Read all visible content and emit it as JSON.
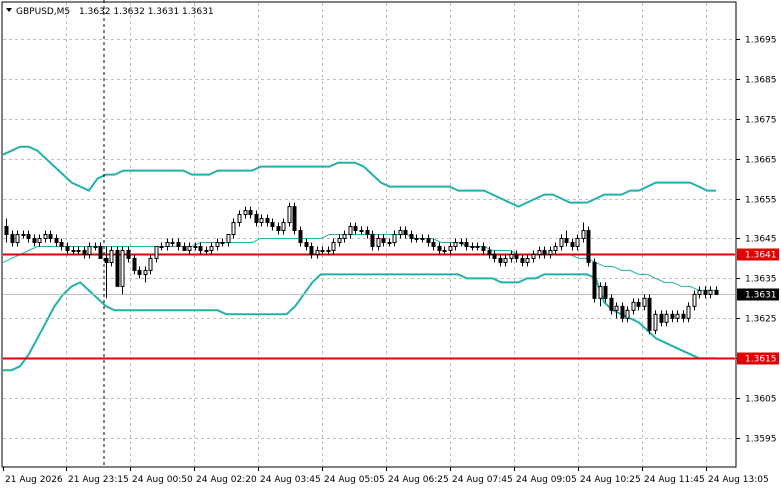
{
  "header": {
    "symbol": "GBPUSD,M5",
    "ohlc": "1.3632 1.3632 1.3631 1.3631"
  },
  "chart_data": {
    "type": "candlestick",
    "ylim": [
      1.3588,
      1.3704
    ],
    "y_ticks": [
      "1.3695",
      "1.3685",
      "1.3675",
      "1.3665",
      "1.3655",
      "1.3645",
      "1.3635",
      "1.3625",
      "1.3615",
      "1.3605",
      "1.3595"
    ],
    "y_tick_values": [
      1.3695,
      1.3685,
      1.3675,
      1.3665,
      1.3655,
      1.3645,
      1.3635,
      1.3625,
      1.3615,
      1.3605,
      1.3595
    ],
    "x_ticks": [
      "21 Aug 2026",
      "21 Aug 23:15",
      "24 Aug 00:50",
      "24 Aug 02:20",
      "24 Aug 03:45",
      "24 Aug 05:05",
      "24 Aug 06:25",
      "24 Aug 07:45",
      "24 Aug 09:05",
      "24 Aug 10:25",
      "24 Aug 11:45",
      "24 Aug 13:05"
    ],
    "grid": true,
    "levels": [
      {
        "label": "1.3641",
        "value": 1.3641,
        "color": "#e00000"
      },
      {
        "label": "1.3615",
        "value": 1.3615,
        "color": "#e00000"
      }
    ],
    "current_price": {
      "label": "1.3631",
      "value": 1.3631
    },
    "candles": [
      [
        1.3648,
        1.365,
        1.3644,
        1.3646
      ],
      [
        1.3646,
        1.3647,
        1.3643,
        1.3644
      ],
      [
        1.3644,
        1.3647,
        1.3643,
        1.3646
      ],
      [
        1.3646,
        1.3647,
        1.3645,
        1.3646
      ],
      [
        1.3646,
        1.3647,
        1.3644,
        1.3645
      ],
      [
        1.3645,
        1.3646,
        1.3643,
        1.3644
      ],
      [
        1.3644,
        1.3646,
        1.3643,
        1.3645
      ],
      [
        1.3645,
        1.3647,
        1.3644,
        1.3646
      ],
      [
        1.3646,
        1.3647,
        1.3644,
        1.3645
      ],
      [
        1.3645,
        1.3646,
        1.3643,
        1.3644
      ],
      [
        1.3644,
        1.3645,
        1.3642,
        1.3643
      ],
      [
        1.3643,
        1.3644,
        1.3641,
        1.3642
      ],
      [
        1.3642,
        1.3643,
        1.3641,
        1.3642
      ],
      [
        1.3642,
        1.3643,
        1.3641,
        1.3642
      ],
      [
        1.3642,
        1.3643,
        1.364,
        1.3641
      ],
      [
        1.3641,
        1.3644,
        1.364,
        1.3643
      ],
      [
        1.3643,
        1.3644,
        1.3642,
        1.3643
      ],
      [
        1.3643,
        1.3644,
        1.364,
        1.364
      ],
      [
        1.364,
        1.3643,
        1.363,
        1.3639
      ],
      [
        1.3639,
        1.3643,
        1.3638,
        1.3642
      ],
      [
        1.3642,
        1.3643,
        1.3633,
        1.3633
      ],
      [
        1.3633,
        1.3643,
        1.3631,
        1.3642
      ],
      [
        1.3642,
        1.3643,
        1.3639,
        1.364
      ],
      [
        1.364,
        1.3641,
        1.3636,
        1.3637
      ],
      [
        1.3637,
        1.3638,
        1.3635,
        1.3636
      ],
      [
        1.3636,
        1.3638,
        1.3634,
        1.3637
      ],
      [
        1.3637,
        1.3641,
        1.3636,
        1.364
      ],
      [
        1.364,
        1.3643,
        1.3639,
        1.3643
      ],
      [
        1.3643,
        1.3644,
        1.3642,
        1.3643
      ],
      [
        1.3643,
        1.3645,
        1.3642,
        1.3644
      ],
      [
        1.3644,
        1.3645,
        1.3643,
        1.3644
      ],
      [
        1.3644,
        1.3645,
        1.3642,
        1.3643
      ],
      [
        1.3643,
        1.3644,
        1.3642,
        1.3642
      ],
      [
        1.3642,
        1.3644,
        1.3641,
        1.3643
      ],
      [
        1.3643,
        1.3644,
        1.3642,
        1.3643
      ],
      [
        1.3643,
        1.3644,
        1.3641,
        1.3642
      ],
      [
        1.3642,
        1.3643,
        1.3641,
        1.3642
      ],
      [
        1.3642,
        1.3644,
        1.3641,
        1.3643
      ],
      [
        1.3643,
        1.3645,
        1.3642,
        1.3644
      ],
      [
        1.3644,
        1.3645,
        1.3643,
        1.3644
      ],
      [
        1.3644,
        1.3646,
        1.3643,
        1.3646
      ],
      [
        1.3646,
        1.365,
        1.3645,
        1.3649
      ],
      [
        1.3649,
        1.3652,
        1.3648,
        1.3651
      ],
      [
        1.3651,
        1.3653,
        1.365,
        1.3652
      ],
      [
        1.3652,
        1.3653,
        1.365,
        1.3651
      ],
      [
        1.3651,
        1.3652,
        1.3648,
        1.3649
      ],
      [
        1.3649,
        1.3651,
        1.3648,
        1.365
      ],
      [
        1.365,
        1.3651,
        1.3648,
        1.3649
      ],
      [
        1.3649,
        1.365,
        1.3647,
        1.3648
      ],
      [
        1.3648,
        1.3649,
        1.3646,
        1.3647
      ],
      [
        1.3647,
        1.365,
        1.3646,
        1.3649
      ],
      [
        1.3649,
        1.3654,
        1.3648,
        1.3653
      ],
      [
        1.3653,
        1.3654,
        1.3646,
        1.3647
      ],
      [
        1.3647,
        1.3648,
        1.3643,
        1.3644
      ],
      [
        1.3644,
        1.3645,
        1.3642,
        1.3643
      ],
      [
        1.3643,
        1.3644,
        1.364,
        1.3641
      ],
      [
        1.3641,
        1.3643,
        1.364,
        1.3642
      ],
      [
        1.3642,
        1.3643,
        1.3641,
        1.3642
      ],
      [
        1.3642,
        1.3643,
        1.3641,
        1.3642
      ],
      [
        1.3642,
        1.3645,
        1.3641,
        1.3644
      ],
      [
        1.3644,
        1.3646,
        1.3643,
        1.3645
      ],
      [
        1.3645,
        1.3647,
        1.3644,
        1.3646
      ],
      [
        1.3646,
        1.3649,
        1.3645,
        1.3648
      ],
      [
        1.3648,
        1.3649,
        1.3646,
        1.3647
      ],
      [
        1.3647,
        1.3648,
        1.3646,
        1.3647
      ],
      [
        1.3647,
        1.3648,
        1.3645,
        1.3646
      ],
      [
        1.3646,
        1.3647,
        1.3642,
        1.3643
      ],
      [
        1.3643,
        1.3646,
        1.3642,
        1.3645
      ],
      [
        1.3645,
        1.3646,
        1.3643,
        1.3644
      ],
      [
        1.3644,
        1.3645,
        1.3643,
        1.3644
      ],
      [
        1.3644,
        1.3647,
        1.3643,
        1.3646
      ],
      [
        1.3646,
        1.3648,
        1.3645,
        1.3647
      ],
      [
        1.3647,
        1.3648,
        1.3645,
        1.3646
      ],
      [
        1.3646,
        1.3647,
        1.3644,
        1.3645
      ],
      [
        1.3645,
        1.3646,
        1.3644,
        1.3645
      ],
      [
        1.3645,
        1.3646,
        1.3644,
        1.3645
      ],
      [
        1.3645,
        1.3646,
        1.3643,
        1.3644
      ],
      [
        1.3644,
        1.3645,
        1.3642,
        1.3643
      ],
      [
        1.3643,
        1.3644,
        1.3641,
        1.3642
      ],
      [
        1.3642,
        1.3643,
        1.3641,
        1.3642
      ],
      [
        1.3642,
        1.3644,
        1.3641,
        1.3643
      ],
      [
        1.3643,
        1.3645,
        1.3642,
        1.3644
      ],
      [
        1.3644,
        1.3645,
        1.3643,
        1.3644
      ],
      [
        1.3644,
        1.3645,
        1.3642,
        1.3643
      ],
      [
        1.3643,
        1.3644,
        1.3642,
        1.3643
      ],
      [
        1.3643,
        1.3644,
        1.3642,
        1.3643
      ],
      [
        1.3643,
        1.3644,
        1.3641,
        1.3642
      ],
      [
        1.3642,
        1.3643,
        1.364,
        1.3641
      ],
      [
        1.3641,
        1.3642,
        1.3639,
        1.364
      ],
      [
        1.364,
        1.3641,
        1.3638,
        1.3639
      ],
      [
        1.3639,
        1.3641,
        1.3638,
        1.364
      ],
      [
        1.364,
        1.3642,
        1.3639,
        1.3641
      ],
      [
        1.3641,
        1.3642,
        1.3639,
        1.364
      ],
      [
        1.364,
        1.3641,
        1.3638,
        1.3639
      ],
      [
        1.3639,
        1.3641,
        1.3638,
        1.364
      ],
      [
        1.364,
        1.3642,
        1.3639,
        1.3641
      ],
      [
        1.3641,
        1.3643,
        1.364,
        1.3642
      ],
      [
        1.3642,
        1.3643,
        1.364,
        1.3641
      ],
      [
        1.3641,
        1.3643,
        1.364,
        1.3642
      ],
      [
        1.3642,
        1.3644,
        1.3641,
        1.3643
      ],
      [
        1.3643,
        1.3646,
        1.3642,
        1.3645
      ],
      [
        1.3645,
        1.3647,
        1.3643,
        1.3644
      ],
      [
        1.3644,
        1.3645,
        1.3642,
        1.3643
      ],
      [
        1.3643,
        1.3646,
        1.3642,
        1.3645
      ],
      [
        1.3645,
        1.3649,
        1.3644,
        1.3647
      ],
      [
        1.3647,
        1.3648,
        1.3638,
        1.3639
      ],
      [
        1.3639,
        1.364,
        1.3629,
        1.363
      ],
      [
        1.363,
        1.3634,
        1.3628,
        1.3633
      ],
      [
        1.3633,
        1.3634,
        1.3629,
        1.363
      ],
      [
        1.363,
        1.3631,
        1.3626,
        1.3627
      ],
      [
        1.3627,
        1.3629,
        1.3625,
        1.3628
      ],
      [
        1.3628,
        1.3629,
        1.3624,
        1.3625
      ],
      [
        1.3625,
        1.3628,
        1.3624,
        1.3627
      ],
      [
        1.3627,
        1.363,
        1.3626,
        1.3629
      ],
      [
        1.3629,
        1.363,
        1.3627,
        1.3628
      ],
      [
        1.3628,
        1.3631,
        1.3627,
        1.363
      ],
      [
        1.363,
        1.3631,
        1.3621,
        1.3622
      ],
      [
        1.3622,
        1.3627,
        1.3621,
        1.3626
      ],
      [
        1.3626,
        1.3627,
        1.3623,
        1.3624
      ],
      [
        1.3624,
        1.3627,
        1.3623,
        1.3626
      ],
      [
        1.3626,
        1.3627,
        1.3624,
        1.3625
      ],
      [
        1.3625,
        1.3627,
        1.3624,
        1.3626
      ],
      [
        1.3626,
        1.3627,
        1.3624,
        1.3625
      ],
      [
        1.3625,
        1.3629,
        1.3624,
        1.3628
      ],
      [
        1.3628,
        1.3632,
        1.3627,
        1.3631
      ],
      [
        1.3631,
        1.3633,
        1.363,
        1.3632
      ],
      [
        1.3632,
        1.3633,
        1.363,
        1.3631
      ],
      [
        1.3631,
        1.3633,
        1.363,
        1.3632
      ],
      [
        1.3632,
        1.3633,
        1.3631,
        1.3631
      ]
    ],
    "bands": {
      "color": "#20b2aa",
      "upper": [
        1.3666,
        1.3667,
        1.3668,
        1.3668,
        1.3667,
        1.3665,
        1.3663,
        1.3661,
        1.3659,
        1.3658,
        1.3657,
        1.366,
        1.3661,
        1.3661,
        1.3662,
        1.3662,
        1.3662,
        1.3662,
        1.3662,
        1.3662,
        1.3662,
        1.3662,
        1.3661,
        1.3661,
        1.3661,
        1.3662,
        1.3662,
        1.3662,
        1.3662,
        1.3662,
        1.3663,
        1.3663,
        1.3663,
        1.3663,
        1.3663,
        1.3663,
        1.3663,
        1.3663,
        1.3663,
        1.3664,
        1.3664,
        1.3664,
        1.3663,
        1.3661,
        1.3659,
        1.3658,
        1.3658,
        1.3658,
        1.3658,
        1.3658,
        1.3658,
        1.3658,
        1.3658,
        1.3657,
        1.3657,
        1.3657,
        1.3657,
        1.3656,
        1.3655,
        1.3654,
        1.3653,
        1.3654,
        1.3655,
        1.3656,
        1.3656,
        1.3655,
        1.3654,
        1.3654,
        1.3654,
        1.3655,
        1.3656,
        1.3656,
        1.3656,
        1.3657,
        1.3657,
        1.3658,
        1.3659,
        1.3659,
        1.3659,
        1.3659,
        1.3659,
        1.3658,
        1.3657,
        1.3657
      ],
      "middle": [
        1.3639,
        1.364,
        1.3641,
        1.3642,
        1.3643,
        1.3643,
        1.3643,
        1.3643,
        1.3643,
        1.3643,
        1.3643,
        1.3643,
        1.3643,
        1.3643,
        1.3643,
        1.3643,
        1.3643,
        1.3643,
        1.3643,
        1.3643,
        1.3643,
        1.3643,
        1.3643,
        1.3644,
        1.3644,
        1.3644,
        1.3644,
        1.3644,
        1.3644,
        1.3644,
        1.3645,
        1.3645,
        1.3645,
        1.3645,
        1.3645,
        1.3645,
        1.3645,
        1.3645,
        1.3646,
        1.3646,
        1.3646,
        1.3646,
        1.3646,
        1.3646,
        1.3646,
        1.3646,
        1.3646,
        1.3646,
        1.3645,
        1.3645,
        1.3645,
        1.3644,
        1.3644,
        1.3644,
        1.3643,
        1.3643,
        1.3643,
        1.3642,
        1.3642,
        1.3642,
        1.3641,
        1.3641,
        1.3641,
        1.3641,
        1.3641,
        1.3641,
        1.3641,
        1.364,
        1.364,
        1.3639,
        1.3638,
        1.3638,
        1.3637,
        1.3637,
        1.3636,
        1.3636,
        1.3635,
        1.3634,
        1.3634,
        1.3633,
        1.3633,
        1.3632,
        1.3632,
        1.3632
      ],
      "lower": [
        1.3612,
        1.3612,
        1.3613,
        1.3616,
        1.362,
        1.3624,
        1.3628,
        1.3631,
        1.3633,
        1.3634,
        1.3632,
        1.363,
        1.3628,
        1.3627,
        1.3627,
        1.3627,
        1.3627,
        1.3627,
        1.3627,
        1.3627,
        1.3627,
        1.3627,
        1.3627,
        1.3627,
        1.3627,
        1.3627,
        1.3626,
        1.3626,
        1.3626,
        1.3626,
        1.3626,
        1.3626,
        1.3626,
        1.3626,
        1.3628,
        1.3631,
        1.3634,
        1.3636,
        1.3636,
        1.3636,
        1.3636,
        1.3636,
        1.3636,
        1.3636,
        1.3636,
        1.3636,
        1.3636,
        1.3636,
        1.3636,
        1.3636,
        1.3636,
        1.3636,
        1.3636,
        1.3636,
        1.3635,
        1.3635,
        1.3635,
        1.3635,
        1.3634,
        1.3634,
        1.3634,
        1.3635,
        1.3635,
        1.3636,
        1.3636,
        1.3636,
        1.3636,
        1.3636,
        1.3636,
        1.3635,
        1.3629,
        1.3627,
        1.3626,
        1.3625,
        1.3624,
        1.3622,
        1.362,
        1.3619,
        1.3618,
        1.3617,
        1.3616,
        1.3615,
        1.3615,
        1.3615
      ]
    }
  }
}
